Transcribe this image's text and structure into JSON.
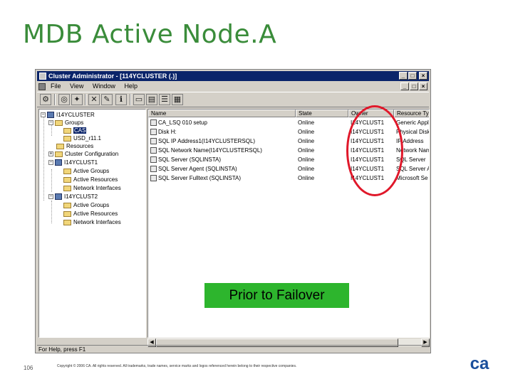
{
  "slide": {
    "title": "MDB Active Node.A",
    "page_number": "106",
    "copyright": "Copyright © 2006 CA. All rights reserved. All trademarks, trade names, service marks and logos referenced herein belong to their respective companies.",
    "annotation_label": "Prior to Failover",
    "annotation_color": "#e0182a",
    "logo_text": "ca"
  },
  "window": {
    "title": "Cluster Administrator  - [114YCLUSTER (.)]",
    "controls": {
      "minimize": "_",
      "maximize": "□",
      "close": "×"
    },
    "menu": [
      "File",
      "View",
      "Window",
      "Help"
    ],
    "status_text": "For Help, press F1"
  },
  "tree": {
    "items": [
      {
        "label": "I14YCLUSTER",
        "icon": "cluster-icon"
      },
      {
        "label": "Groups",
        "icon": "folder-icon"
      },
      {
        "label": "CAS",
        "icon": "folder-icon",
        "selected": true
      },
      {
        "label": "USD_r11.1",
        "icon": "folder-icon"
      },
      {
        "label": "Resources",
        "icon": "folder-icon"
      },
      {
        "label": "Cluster Configuration",
        "icon": "folder-icon"
      },
      {
        "label": "I14YCLUST1",
        "icon": "node-icon"
      },
      {
        "label": "Active Groups",
        "icon": "folder-icon"
      },
      {
        "label": "Active Resources",
        "icon": "folder-icon"
      },
      {
        "label": "Network Interfaces",
        "icon": "folder-icon"
      },
      {
        "label": "I14YCLUST2",
        "icon": "node-icon"
      },
      {
        "label": "Active Groups",
        "icon": "folder-icon"
      },
      {
        "label": "Active Resources",
        "icon": "folder-icon"
      },
      {
        "label": "Network Interfaces",
        "icon": "folder-icon"
      }
    ]
  },
  "list": {
    "columns": [
      "Name",
      "State",
      "Owner",
      "Resource Type"
    ],
    "rows": [
      {
        "name": "CA_LSQ 010 setup",
        "state": "Online",
        "owner": "I14YCLUST1",
        "type": "Generic Appl"
      },
      {
        "name": "Disk H:",
        "state": "Online",
        "owner": "I14YCLUST1",
        "type": "Physical Disk"
      },
      {
        "name": "SQL IP Address1(I14YCLUSTERSQL)",
        "state": "Online",
        "owner": "I14YCLUST1",
        "type": "IP Address"
      },
      {
        "name": "SQL Network Name(I14YCLUSTERSQL)",
        "state": "Online",
        "owner": "I14YCLUST1",
        "type": "Network Name"
      },
      {
        "name": "SQL Server (SQLINSTA)",
        "state": "Online",
        "owner": "I14YCLUST1",
        "type": "SQL Server"
      },
      {
        "name": "SQL Server Agent (SQLINSTA)",
        "state": "Online",
        "owner": "I14YCLUST1",
        "type": "SQL Server A"
      },
      {
        "name": "SQL Server Fulltext (SQLINSTA)",
        "state": "Online",
        "owner": "I14YCLUST1",
        "type": "Microsoft Se"
      }
    ]
  }
}
